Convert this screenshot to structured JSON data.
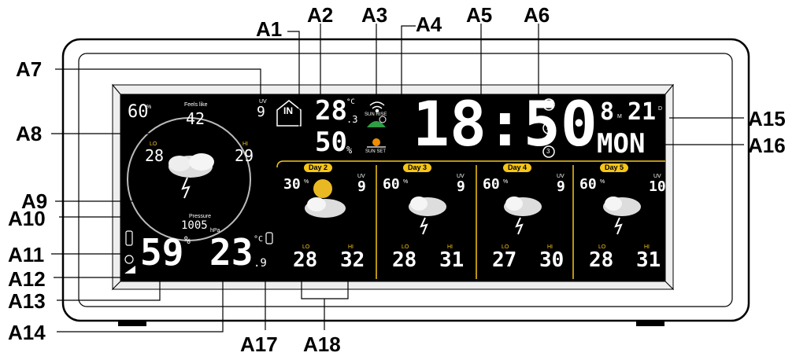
{
  "callouts": {
    "a1": "A1",
    "a2": "A2",
    "a3": "A3",
    "a4": "A4",
    "a5": "A5",
    "a6": "A6",
    "a7": "A7",
    "a8": "A8",
    "a9": "A9",
    "a10": "A10",
    "a11": "A11",
    "a12": "A12",
    "a13": "A13",
    "a14": "A14",
    "a15": "A15",
    "a16": "A16",
    "a17": "A17",
    "a18": "A18"
  },
  "left_panel": {
    "rain_pct": "60",
    "pct_sign": "%",
    "feels_like_label": "Feels like",
    "feels_like": "42",
    "uv_label": "UV",
    "uv": "9",
    "lo_label": "LO",
    "lo": "28",
    "hi_label": "HI",
    "hi": "29",
    "pressure_label": "Pressure",
    "pressure": "1005",
    "pressure_unit": "hPa",
    "humidity": "59",
    "humidity_sign": "%",
    "temp": "23",
    "temp_dec": ".9",
    "temp_unit": "°C"
  },
  "indoor": {
    "in_label": "IN",
    "temp": "28",
    "temp_dec": ".3",
    "temp_unit": "°C",
    "humidity": "50",
    "humidity_sign": "%",
    "sun_rise": "SUN RISE",
    "sun_set": "SUN SET"
  },
  "clock": {
    "time": "18:50",
    "alarm1": "1",
    "alarm2": "2",
    "alarm3": "3"
  },
  "date": {
    "month": "8",
    "m_label": "M",
    "day": "21",
    "d_label": "D",
    "weekday": "MON"
  },
  "forecast": [
    {
      "day": "Day 2",
      "rain": "30",
      "uv": "9",
      "lo": "28",
      "hi": "32"
    },
    {
      "day": "Day 3",
      "rain": "60",
      "uv": "9",
      "lo": "28",
      "hi": "31"
    },
    {
      "day": "Day 4",
      "rain": "60",
      "uv": "9",
      "lo": "27",
      "hi": "30"
    },
    {
      "day": "Day 5",
      "rain": "60",
      "uv": "10",
      "lo": "28",
      "hi": "31"
    }
  ],
  "forecast_labels": {
    "uv": "UV",
    "lo": "LO",
    "hi": "HI"
  },
  "colors": {
    "accent": "#f5c518",
    "lcd_bg": "#000000",
    "lcd_text": "#ffffff",
    "sun_green": "#2f9e44",
    "sun_orange": "#f08c00"
  }
}
